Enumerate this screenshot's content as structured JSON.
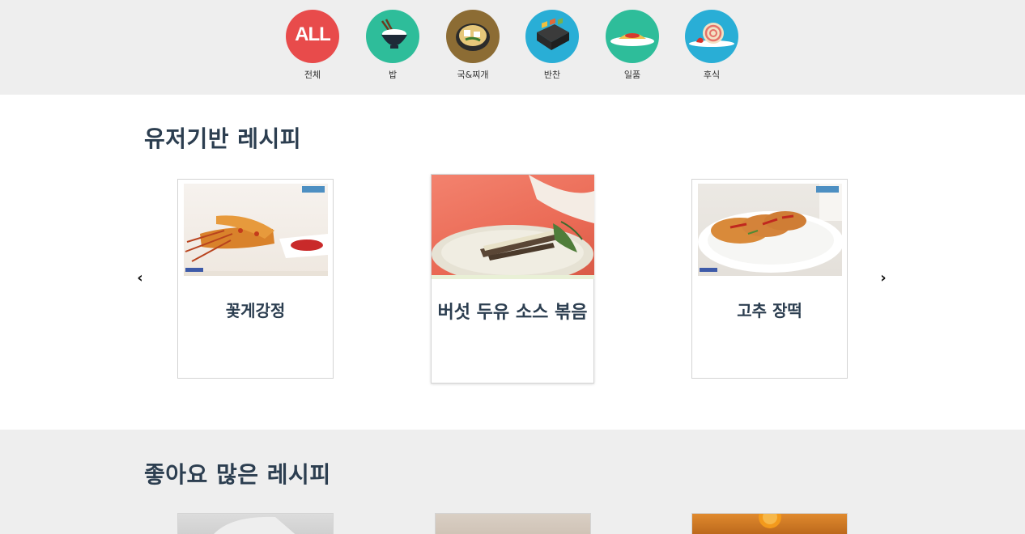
{
  "categories": [
    {
      "label": "전체",
      "badge": "ALL",
      "icon": "all-icon",
      "color": "#e84b4b"
    },
    {
      "label": "밥",
      "icon": "rice-bowl-icon",
      "color": "#2ebd9a"
    },
    {
      "label": "국&찌개",
      "icon": "stew-icon",
      "color": "#8c6c34"
    },
    {
      "label": "반찬",
      "icon": "side-dish-box-icon",
      "color": "#29aed6"
    },
    {
      "label": "일품",
      "icon": "main-dish-plate-icon",
      "color": "#2ebd9a"
    },
    {
      "label": "후식",
      "icon": "dessert-roll-cake-icon",
      "color": "#29aed6"
    }
  ],
  "user_recipes": {
    "title": "유저기반 레시피",
    "prev_icon": "chevron-left-icon",
    "next_icon": "chevron-right-icon",
    "cards": [
      {
        "name": "꽃게강정"
      },
      {
        "name": "버섯 두유 소스 볶음"
      },
      {
        "name": "고추 장떡"
      }
    ]
  },
  "popular_recipes": {
    "title": "좋아요 많은 레시피"
  },
  "colors": {
    "title": "#2c3e50",
    "category_bar_bg": "#eeeeee"
  }
}
